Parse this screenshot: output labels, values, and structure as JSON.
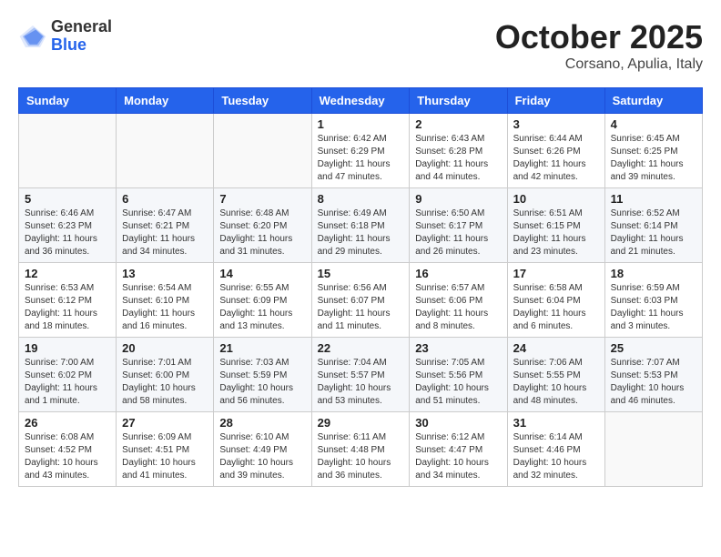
{
  "header": {
    "logo": {
      "general": "General",
      "blue": "Blue"
    },
    "title": "October 2025",
    "location": "Corsano, Apulia, Italy"
  },
  "weekdays": [
    "Sunday",
    "Monday",
    "Tuesday",
    "Wednesday",
    "Thursday",
    "Friday",
    "Saturday"
  ],
  "weeks": [
    [
      {
        "day": "",
        "info": ""
      },
      {
        "day": "",
        "info": ""
      },
      {
        "day": "",
        "info": ""
      },
      {
        "day": "1",
        "info": "Sunrise: 6:42 AM\nSunset: 6:29 PM\nDaylight: 11 hours\nand 47 minutes."
      },
      {
        "day": "2",
        "info": "Sunrise: 6:43 AM\nSunset: 6:28 PM\nDaylight: 11 hours\nand 44 minutes."
      },
      {
        "day": "3",
        "info": "Sunrise: 6:44 AM\nSunset: 6:26 PM\nDaylight: 11 hours\nand 42 minutes."
      },
      {
        "day": "4",
        "info": "Sunrise: 6:45 AM\nSunset: 6:25 PM\nDaylight: 11 hours\nand 39 minutes."
      }
    ],
    [
      {
        "day": "5",
        "info": "Sunrise: 6:46 AM\nSunset: 6:23 PM\nDaylight: 11 hours\nand 36 minutes."
      },
      {
        "day": "6",
        "info": "Sunrise: 6:47 AM\nSunset: 6:21 PM\nDaylight: 11 hours\nand 34 minutes."
      },
      {
        "day": "7",
        "info": "Sunrise: 6:48 AM\nSunset: 6:20 PM\nDaylight: 11 hours\nand 31 minutes."
      },
      {
        "day": "8",
        "info": "Sunrise: 6:49 AM\nSunset: 6:18 PM\nDaylight: 11 hours\nand 29 minutes."
      },
      {
        "day": "9",
        "info": "Sunrise: 6:50 AM\nSunset: 6:17 PM\nDaylight: 11 hours\nand 26 minutes."
      },
      {
        "day": "10",
        "info": "Sunrise: 6:51 AM\nSunset: 6:15 PM\nDaylight: 11 hours\nand 23 minutes."
      },
      {
        "day": "11",
        "info": "Sunrise: 6:52 AM\nSunset: 6:14 PM\nDaylight: 11 hours\nand 21 minutes."
      }
    ],
    [
      {
        "day": "12",
        "info": "Sunrise: 6:53 AM\nSunset: 6:12 PM\nDaylight: 11 hours\nand 18 minutes."
      },
      {
        "day": "13",
        "info": "Sunrise: 6:54 AM\nSunset: 6:10 PM\nDaylight: 11 hours\nand 16 minutes."
      },
      {
        "day": "14",
        "info": "Sunrise: 6:55 AM\nSunset: 6:09 PM\nDaylight: 11 hours\nand 13 minutes."
      },
      {
        "day": "15",
        "info": "Sunrise: 6:56 AM\nSunset: 6:07 PM\nDaylight: 11 hours\nand 11 minutes."
      },
      {
        "day": "16",
        "info": "Sunrise: 6:57 AM\nSunset: 6:06 PM\nDaylight: 11 hours\nand 8 minutes."
      },
      {
        "day": "17",
        "info": "Sunrise: 6:58 AM\nSunset: 6:04 PM\nDaylight: 11 hours\nand 6 minutes."
      },
      {
        "day": "18",
        "info": "Sunrise: 6:59 AM\nSunset: 6:03 PM\nDaylight: 11 hours\nand 3 minutes."
      }
    ],
    [
      {
        "day": "19",
        "info": "Sunrise: 7:00 AM\nSunset: 6:02 PM\nDaylight: 11 hours\nand 1 minute."
      },
      {
        "day": "20",
        "info": "Sunrise: 7:01 AM\nSunset: 6:00 PM\nDaylight: 10 hours\nand 58 minutes."
      },
      {
        "day": "21",
        "info": "Sunrise: 7:03 AM\nSunset: 5:59 PM\nDaylight: 10 hours\nand 56 minutes."
      },
      {
        "day": "22",
        "info": "Sunrise: 7:04 AM\nSunset: 5:57 PM\nDaylight: 10 hours\nand 53 minutes."
      },
      {
        "day": "23",
        "info": "Sunrise: 7:05 AM\nSunset: 5:56 PM\nDaylight: 10 hours\nand 51 minutes."
      },
      {
        "day": "24",
        "info": "Sunrise: 7:06 AM\nSunset: 5:55 PM\nDaylight: 10 hours\nand 48 minutes."
      },
      {
        "day": "25",
        "info": "Sunrise: 7:07 AM\nSunset: 5:53 PM\nDaylight: 10 hours\nand 46 minutes."
      }
    ],
    [
      {
        "day": "26",
        "info": "Sunrise: 6:08 AM\nSunset: 4:52 PM\nDaylight: 10 hours\nand 43 minutes."
      },
      {
        "day": "27",
        "info": "Sunrise: 6:09 AM\nSunset: 4:51 PM\nDaylight: 10 hours\nand 41 minutes."
      },
      {
        "day": "28",
        "info": "Sunrise: 6:10 AM\nSunset: 4:49 PM\nDaylight: 10 hours\nand 39 minutes."
      },
      {
        "day": "29",
        "info": "Sunrise: 6:11 AM\nSunset: 4:48 PM\nDaylight: 10 hours\nand 36 minutes."
      },
      {
        "day": "30",
        "info": "Sunrise: 6:12 AM\nSunset: 4:47 PM\nDaylight: 10 hours\nand 34 minutes."
      },
      {
        "day": "31",
        "info": "Sunrise: 6:14 AM\nSunset: 4:46 PM\nDaylight: 10 hours\nand 32 minutes."
      },
      {
        "day": "",
        "info": ""
      }
    ]
  ]
}
